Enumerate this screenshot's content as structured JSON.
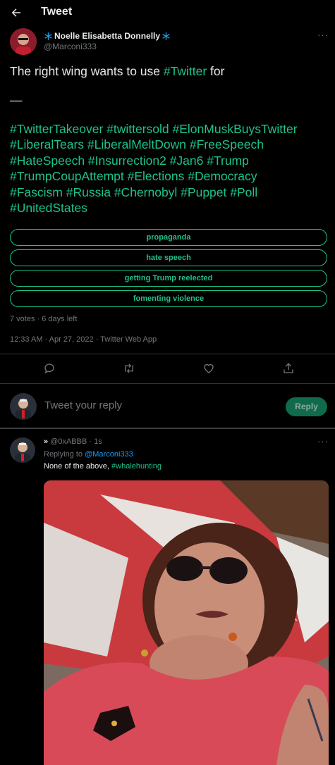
{
  "header": {
    "title": "Tweet"
  },
  "author": {
    "name": "Noelle Elisabetta Donnelly",
    "handle": "@Marconi333"
  },
  "tweet": {
    "line1_text": "The right wing wants to use ",
    "line1_link": "#Twitter",
    "line1_end": " for",
    "dash": "—",
    "hashtag_lines": [
      "#TwitterTakeover #twittersold #ElonMuskBuysTwitter",
      "#LiberalTears #LiberalMeltDown #FreeSpeech",
      "#HateSpeech #Insurrection2 #Jan6 #Trump",
      "#TrumpCoupAttempt #Elections #Democracy",
      "#Fascism #Russia #Chernobyl #Puppet #Poll",
      "#UnitedStates"
    ]
  },
  "poll": {
    "options": [
      "propaganda",
      "hate speech",
      "getting Trump reelected",
      "fomenting violence"
    ],
    "status": "7 votes · 6 days left"
  },
  "timestamp": "12:33 AM · Apr 27, 2022 · Twitter Web App",
  "composer": {
    "placeholder": "Tweet your reply",
    "button": "Reply"
  },
  "reply": {
    "name_prefix": "»",
    "handle": "@0xABBB",
    "time": "· 1s",
    "replying_prefix": "Replying to ",
    "replying_to": "@Marconi333",
    "text": "None of the above, ",
    "hashtag": "#whalehunting"
  },
  "colors": {
    "accent_link": "#1d9bf0",
    "hashtag": "#1ec28b",
    "background": "#000000",
    "muted": "#71767b"
  }
}
